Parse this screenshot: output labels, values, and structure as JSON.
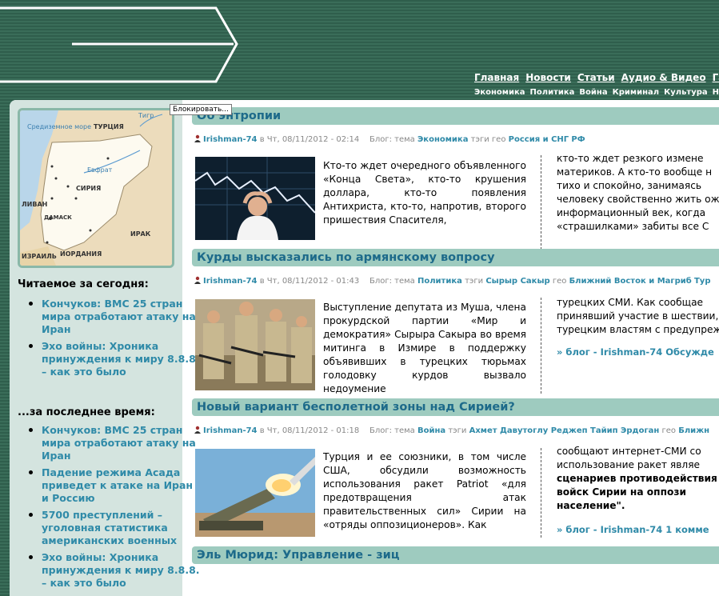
{
  "header": {
    "nav_main": [
      "Главная",
      "Новости",
      "Статьи",
      "Аудио & Видео",
      "Гал"
    ],
    "nav_sub": [
      "Экономика",
      "Политика",
      "Война",
      "Криминал",
      "Культура",
      "Нравы"
    ]
  },
  "tooltip": "Блокировать...",
  "map": {
    "labels": [
      "Средиземное море",
      "ТУРЦИЯ",
      "Тигр",
      "Евфрат",
      "СИРИЯ",
      "ЛИВАН",
      "ДАМАСК",
      "ИРАК",
      "ИЗРАИЛЬ",
      "ИОРДАНИЯ"
    ]
  },
  "sidebar": {
    "today_heading": "Читаемое за сегодня:",
    "today_items": [
      "Кончуков: ВМС 25 стран мира отработают атаку на Иран",
      "Эхо войны: Хроника принуждения к миру 8.8.8. – как это было"
    ],
    "recent_heading": "...за последнее время:",
    "recent_items": [
      "Кончуков: ВМС 25 стран мира отработают атаку на Иран",
      "Падение режима Асада приведет к атаке на Иран и Россию",
      "5700 преступлений – уголовная статистика американских военных",
      "Эхо войны: Хроника принуждения к миру 8.8.8. – как это было"
    ]
  },
  "articles": [
    {
      "title": "Об энтропии",
      "author": "Irishman-74",
      "date": "в Чт, 08/11/2012 - 02:14",
      "blog_label": "Блог: тема",
      "topic": "Экономика",
      "tags_label": "тэги",
      "geo_label": "гео",
      "geo": "Россия и СНГ",
      "extra": "РФ",
      "lead": "Кто-то ждет очередного объявленного «Конца Света», кто-то крушения доллара, кто-то появления Антихриста, кто-то, напротив, второго пришествия Спасителя,",
      "cont": [
        "кто-то ждет резкого измене",
        "материков. А кто-то вообще н",
        "тихо и спокойно, занимаясь",
        "человеку свойственно жить ож",
        "информационный век, когда",
        "«страшилками» забиты все С"
      ],
      "more": ""
    },
    {
      "title": "Курды высказались по армянскому вопросу",
      "author": "Irishman-74",
      "date": "в Чт, 08/11/2012 - 01:43",
      "blog_label": "Блог: тема",
      "topic": "Политика",
      "tags_label": "тэги",
      "tags": "Сырыр Сакыр",
      "geo_label": "гео",
      "geo": "Ближний Восток и Магриб",
      "extra": "Тур",
      "lead": "Выступление депутата из Муша, члена прокурдской партии «Мир и демократия» Сырыра Сакыра во время митинга в Измире в поддержку объявивших в турецких тюрьмах голодовку курдов вызвало недоумение",
      "cont": [
        "турецких СМИ. Как сообщае",
        "принявший участие в шествии,",
        "турецким властям с предупреж"
      ],
      "more": "» блог - Irishman-74  Обсужде"
    },
    {
      "title": "Новый вариант бесполетной зоны над Сирией?",
      "author": "Irishman-74",
      "date": "в Чт, 08/11/2012 - 01:18",
      "blog_label": "Блог: тема",
      "topic": "Война",
      "tags_label": "тэги",
      "tags": "Ахмет Давутоглу  Реджеп Тайип Эрдоган",
      "geo_label": "гео",
      "geo": "Ближн",
      "lead": "Турция и ее союзники, в том числе США, обсудили возможность использования ракет Patriot «для предотвращения атак правительственных сил» Сирии на «отряды оппозиционеров». Как",
      "cont": [
        "сообщают интернет-СМИ со",
        "использование ракет являе",
        "сценариев противодействия",
        "войск Сирии на оппози",
        "население\"."
      ],
      "more": "» блог - Irishman-74  1 комме"
    },
    {
      "title": "Эль Мюрид: Управление - зиц"
    }
  ]
}
